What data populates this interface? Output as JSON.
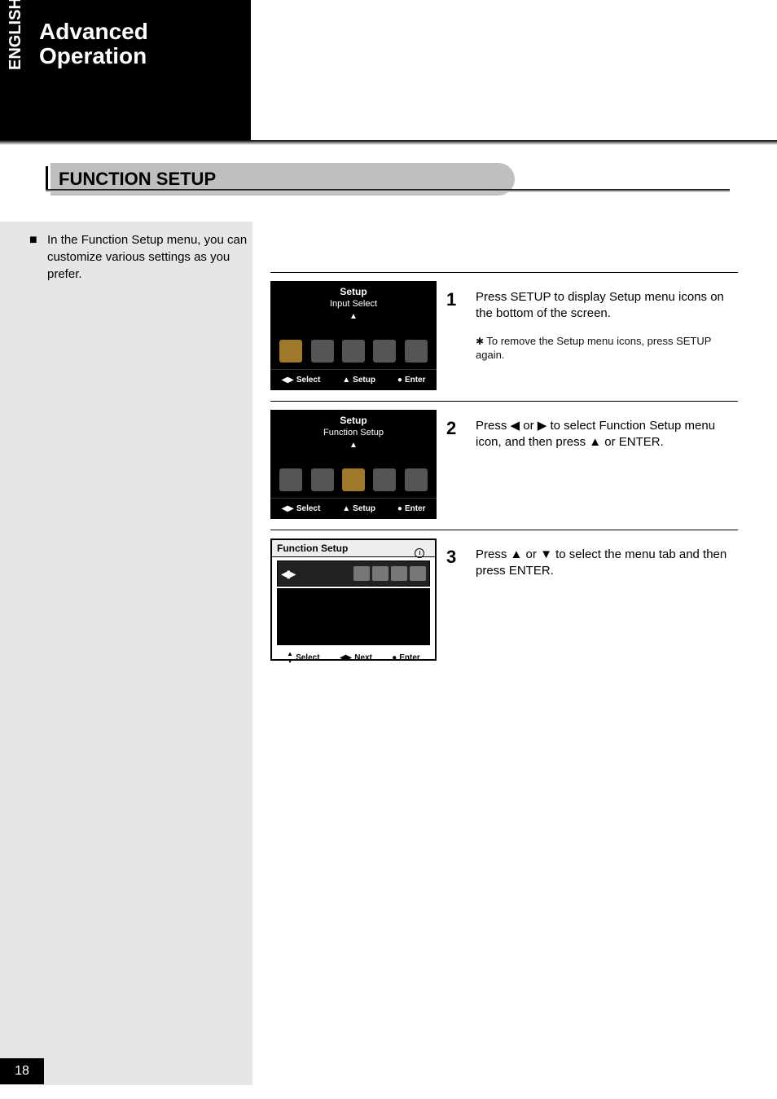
{
  "corner": {
    "vertical": "ENGLISH",
    "line1": "Advanced",
    "line2": "Operation"
  },
  "title": "FUNCTION SETUP",
  "sidebar": {
    "bullet": "■",
    "text": "In the Function Setup menu, you can customize various settings as you prefer."
  },
  "steps": [
    {
      "num": "1",
      "body": "Press SETUP to display Setup menu icons on the bottom of the screen.",
      "note": "To remove the Setup menu icons, press SETUP again.",
      "shot": {
        "title": "Setup",
        "sub": "Input Select",
        "tri": "▲",
        "icons": [
          "sel",
          "",
          "",
          "",
          ""
        ],
        "hint_select": "Select",
        "hint_setup": "Setup",
        "hint_enter": "Enter"
      }
    },
    {
      "num": "2",
      "body_parts": [
        "Press ",
        "◀",
        " or ",
        "▶",
        " to select Function Setup menu icon, and then press ",
        "▲",
        " or ENTER."
      ],
      "shot": {
        "title": "Setup",
        "sub": "Function Setup",
        "tri": "▲",
        "icons": [
          "",
          "",
          "sel",
          "",
          ""
        ],
        "hint_select": "Select",
        "hint_setup": "Setup",
        "hint_enter": "Enter"
      }
    },
    {
      "num": "3",
      "body_parts": [
        "Press ",
        "▲",
        " or ",
        "▼",
        " to select the menu tab and then press ENTER."
      ],
      "shot": {
        "head": "Function Setup",
        "hint_select": "Select",
        "hint_next": "Next",
        "hint_enter": "Enter"
      }
    }
  ],
  "pagenum": "18"
}
